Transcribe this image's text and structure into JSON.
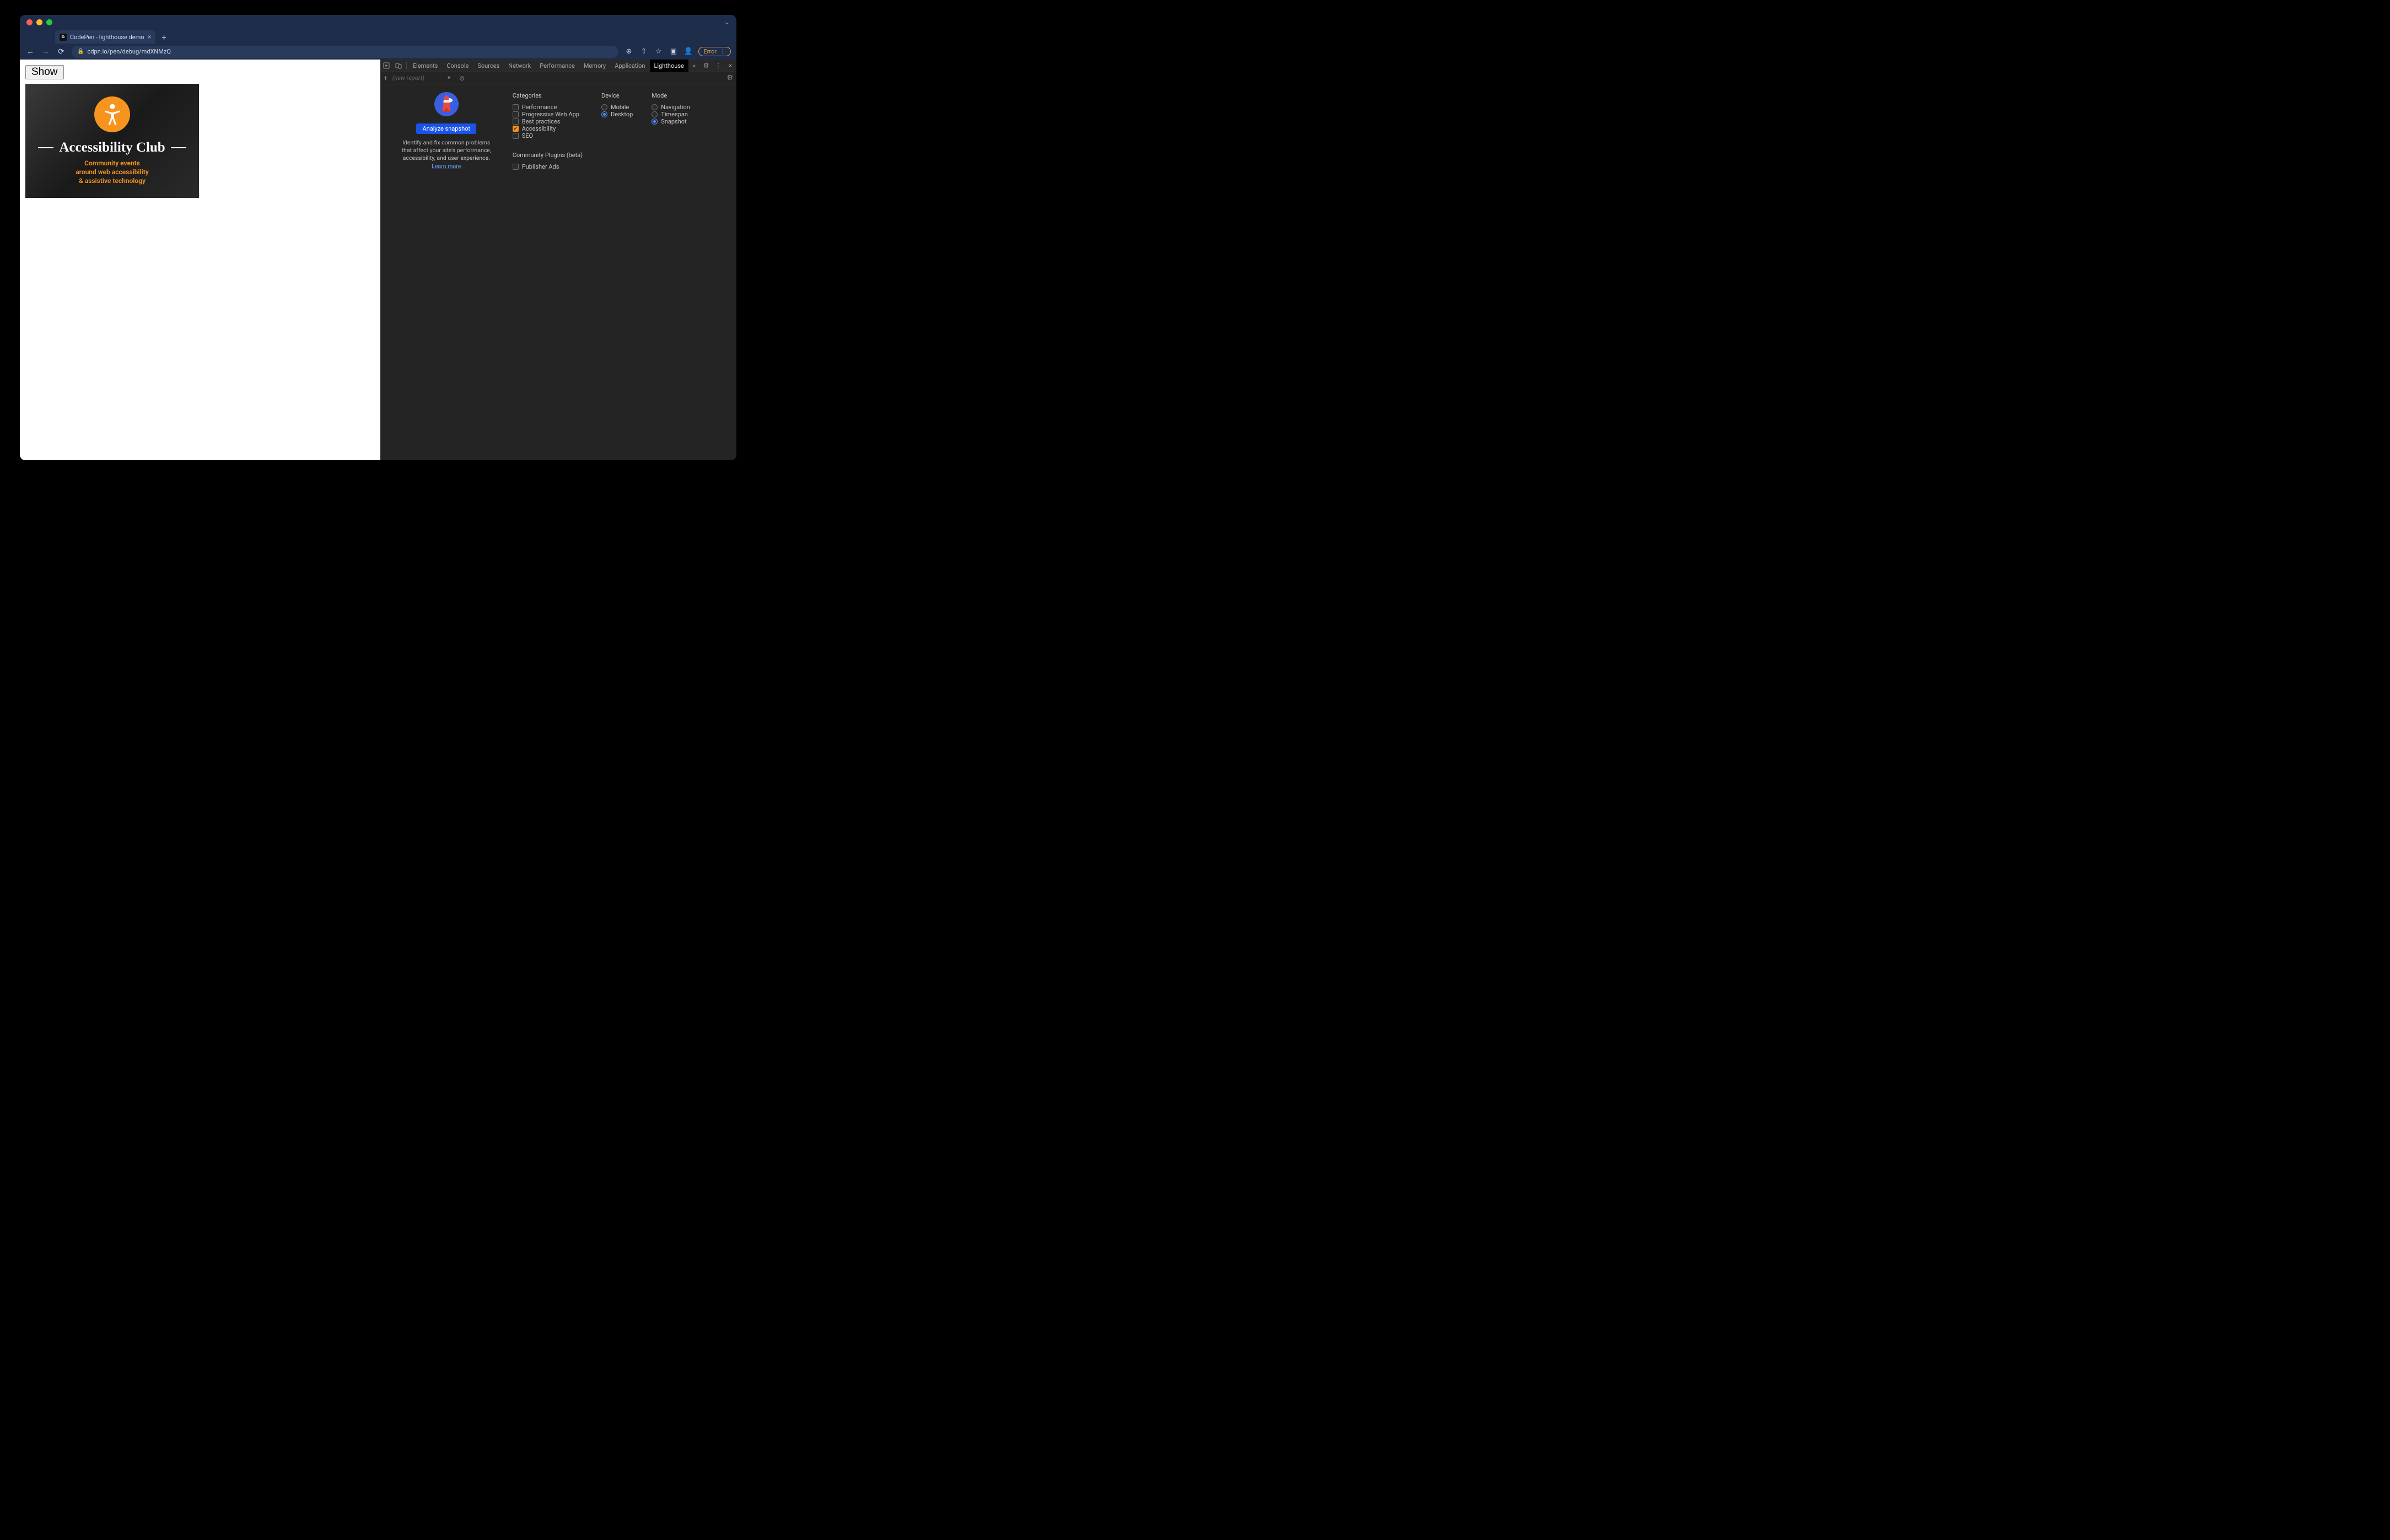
{
  "browser": {
    "tab_title": "CodePen - lighthouse demo",
    "url": "cdpn.io/pen/debug/mdXNMzQ",
    "error_label": "Error"
  },
  "page": {
    "show_button": "Show",
    "card_title": "Accessibility Club",
    "card_sub1": "Community events",
    "card_sub2": "around web accessibility",
    "card_sub3": "& assistive technology"
  },
  "devtools": {
    "tabs": {
      "elements": "Elements",
      "console": "Console",
      "sources": "Sources",
      "network": "Network",
      "performance": "Performance",
      "memory": "Memory",
      "application": "Application",
      "lighthouse": "Lighthouse",
      "more": "»"
    },
    "new_report": "(new report)",
    "lighthouse": {
      "analyze_button": "Analyze snapshot",
      "description": "Identify and fix common problems that affect your site's performance, accessibility, and user experience.",
      "learn_more": "Learn more",
      "categories_label": "Categories",
      "categories": [
        {
          "label": "Performance",
          "checked": false
        },
        {
          "label": "Progressive Web App",
          "checked": false
        },
        {
          "label": "Best practices",
          "checked": false
        },
        {
          "label": "Accessibility",
          "checked": true
        },
        {
          "label": "SEO",
          "checked": false
        }
      ],
      "plugins_label": "Community Plugins (beta)",
      "plugins": [
        {
          "label": "Publisher Ads",
          "checked": false
        }
      ],
      "device_label": "Device",
      "device": [
        {
          "label": "Mobile",
          "checked": false
        },
        {
          "label": "Desktop",
          "checked": true
        }
      ],
      "mode_label": "Mode",
      "mode": [
        {
          "label": "Navigation",
          "checked": false
        },
        {
          "label": "Timespan",
          "checked": false
        },
        {
          "label": "Snapshot",
          "checked": true
        }
      ]
    }
  }
}
